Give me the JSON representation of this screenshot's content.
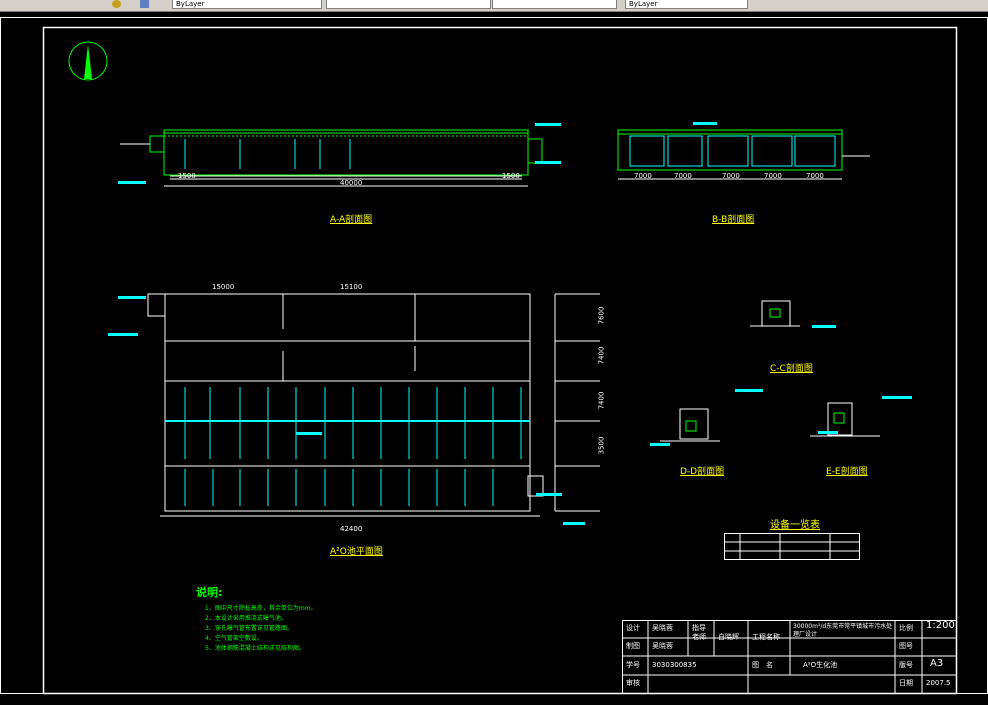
{
  "toolbar": {
    "fields": [
      "ByLayer",
      "",
      "",
      "ByLayer",
      ""
    ]
  },
  "drawing": {
    "sections": {
      "aa": "A-A剖面图",
      "bb": "B-B剖面图",
      "plan": "A²O池平面图",
      "cc": "C-C剖面图",
      "dd": "D-D剖面图",
      "ee": "E-E剖面图"
    },
    "dims": {
      "aa_bottom": [
        "1500",
        "40000",
        "1500"
      ],
      "bb_bottom": [
        "7000",
        "7000",
        "7000",
        "7000",
        "7000"
      ],
      "plan_top": [
        "15000",
        "15100"
      ],
      "plan_bottom": "42400",
      "plan_right": [
        "7600",
        "7400",
        "7400",
        "3500"
      ]
    },
    "equipment_list_title": "设备一览表",
    "notes": {
      "title": "说明:",
      "items": [
        "1、图中尺寸除标高外，其余单位为mm。",
        "2、本设计采用推流式曝气池。",
        "3、穿孔曝气管布置详见管路图。",
        "4、空气管架空敷设。",
        "5、池体钢筋混凝土结构详见结构图。"
      ]
    }
  },
  "title_block": {
    "design_label": "设计",
    "design_name": "吴晓蓉",
    "draw_label": "制图",
    "draw_name": "吴晓蓉",
    "advisor_label": "指导老师",
    "advisor_name": "白晓辉",
    "project_label": "工程名称",
    "project_name": "30000m³/d东莞市常平镇城市污水处理厂设计",
    "ratio_label": "比例",
    "ratio_value": "1:200",
    "sheet_label": "图号",
    "student_label": "学号",
    "student_no": "3030300835",
    "drawing_label": "图　名",
    "drawing_name": "A²O生化池",
    "no_label": "版号",
    "size_value": "A3",
    "review_label": "审核",
    "date_label": "日期",
    "date_value": "2007.5"
  }
}
